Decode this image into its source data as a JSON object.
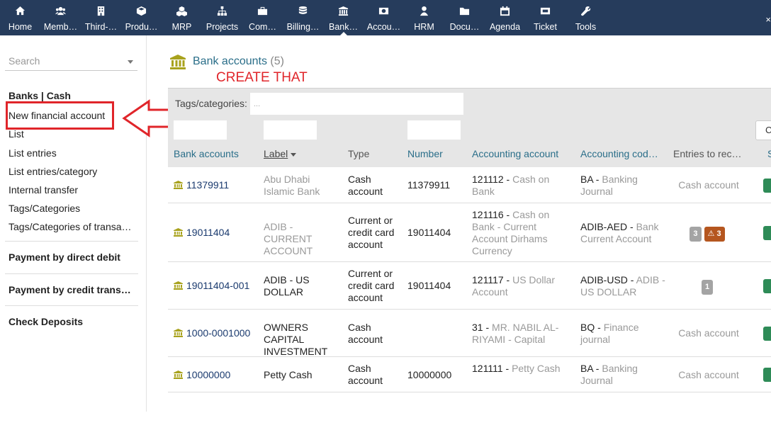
{
  "topbar": {
    "items": [
      {
        "label": "Home",
        "icon": "home-icon"
      },
      {
        "label": "Memb…",
        "icon": "users-icon"
      },
      {
        "label": "Third-…",
        "icon": "building-icon"
      },
      {
        "label": "Produ…",
        "icon": "cube-icon"
      },
      {
        "label": "MRP",
        "icon": "cubes-icon"
      },
      {
        "label": "Projects",
        "icon": "sitemap-icon"
      },
      {
        "label": "Com…",
        "icon": "briefcase-icon"
      },
      {
        "label": "Billing…",
        "icon": "coins-icon"
      },
      {
        "label": "Bank…",
        "icon": "bank-icon",
        "active": true
      },
      {
        "label": "Accou…",
        "icon": "money-icon"
      },
      {
        "label": "HRM",
        "icon": "user-icon"
      },
      {
        "label": "Docu…",
        "icon": "folder-icon"
      },
      {
        "label": "Agenda",
        "icon": "calendar-icon"
      },
      {
        "label": "Ticket",
        "icon": "ticket-icon"
      },
      {
        "label": "Tools",
        "icon": "wrench-icon"
      }
    ],
    "right_label": "×"
  },
  "sidebar": {
    "search_placeholder": "Search",
    "section1_title": "Banks | Cash",
    "links": [
      "New financial account",
      "List",
      "List entries",
      "List entries/category",
      "Internal transfer",
      "Tags/Categories",
      "Tags/Categories of transa…"
    ],
    "section2_title": "Payment by direct debit",
    "section3_title": "Payment by credit trans…",
    "section4_title": "Check Deposits"
  },
  "annotation": "CREATE THAT\nACCOUNT HERE",
  "main": {
    "title": "Bank accounts",
    "count": "(5)",
    "tags_label": "Tags/categories:",
    "tags_placeholder": "...",
    "right_button": "C",
    "columns": [
      "Bank accounts",
      "Label",
      "Type",
      "Number",
      "Accounting account",
      "Accounting cod…",
      "Entries to rec…",
      "S"
    ],
    "rows": [
      {
        "ref": "11379911",
        "label": "Abu Dhabi Islamic Bank",
        "label_muted": true,
        "type": "Cash account",
        "number": "11379911",
        "acc_code": "121112",
        "acc_name": "Cash on Bank",
        "journal_code": "BA",
        "journal_name": "Banking Journal",
        "entries": "Cash account",
        "badges": []
      },
      {
        "ref": "19011404",
        "label": "ADIB - CURRENT ACCOUNT",
        "label_muted": true,
        "type": "Current or credit card account",
        "number": "19011404",
        "acc_code": "121116",
        "acc_name": "Cash on Bank - Current Account Dirhams Currency",
        "journal_code": "ADIB-AED",
        "journal_name": "Bank Current Account",
        "entries": "",
        "badges": [
          "3",
          "3"
        ]
      },
      {
        "ref": "19011404-001",
        "label": "ADIB - US DOLLAR",
        "label_muted": false,
        "type": "Current or credit card account",
        "number": "19011404",
        "acc_code": "121117",
        "acc_name": "US Dollar Account",
        "journal_code": "ADIB-USD",
        "journal_name": "ADIB - US DOLLAR",
        "entries": "",
        "badges": [
          "1"
        ]
      },
      {
        "ref": "1000-0001000",
        "label": "OWNERS CAPITAL INVESTMENT",
        "label_muted": false,
        "type": "Cash account",
        "number": "",
        "acc_code": "31",
        "acc_name": "MR. NABIL AL-RIYAMI - Capital",
        "journal_code": "BQ",
        "journal_name": "Finance journal",
        "entries": "Cash account",
        "badges": []
      },
      {
        "ref": "10000000",
        "label": "Petty Cash",
        "label_muted": false,
        "type": "Cash account",
        "number": "10000000",
        "acc_code": "121111",
        "acc_name": "Petty Cash",
        "journal_code": "BA",
        "journal_name": "Banking Journal",
        "entries": "Cash account",
        "badges": []
      }
    ]
  },
  "colors": {
    "topbar": "#263c5c",
    "link": "#2a6e89",
    "annotation": "#e0252a",
    "bank_icon": "#a8a21d",
    "status": "#2e8b57"
  }
}
